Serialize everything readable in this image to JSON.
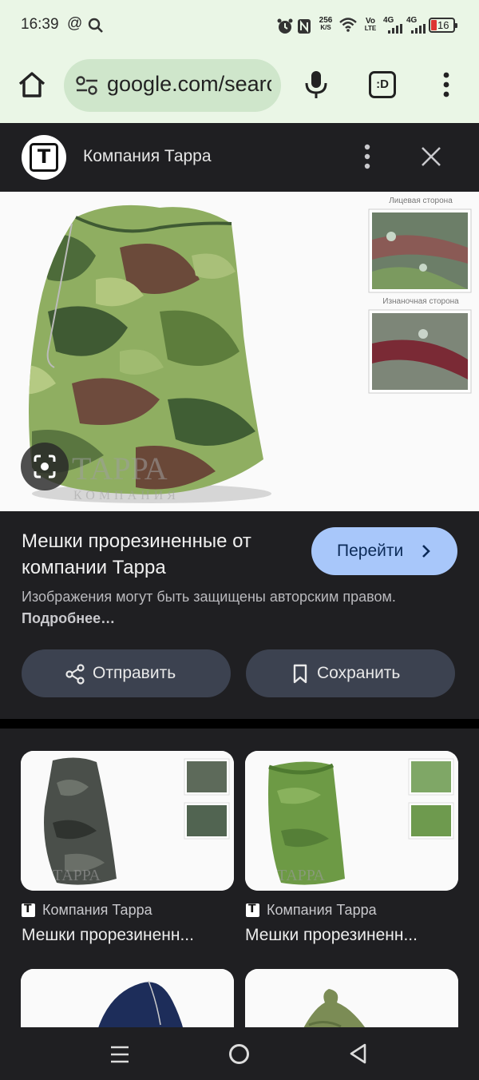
{
  "status_bar": {
    "time": "16:39",
    "at_icon": "@",
    "net_speed_value": "256",
    "net_speed_unit": "K/S",
    "volte_top": "Vo",
    "volte_bottom": "LTE",
    "signal1": "4G",
    "signal2": "4G",
    "battery": "16",
    "colors": {
      "battery_low": "#dd3333"
    }
  },
  "browser": {
    "url": "google.com/search",
    "tab_switcher_label": ":D"
  },
  "viewer": {
    "source_name": "Компания Тарра",
    "logo_letter": "T",
    "title": "Мешки прорезиненные от компании Тарра",
    "go_button": "Перейти",
    "copyright_text": "Изображения могут быть защищены авторским правом.",
    "copyright_link": "Подробнее…",
    "share_button": "Отправить",
    "save_button": "Сохранить",
    "image": {
      "watermark": "ТАРРА",
      "watermark_sub": "КОМПАНИЯ",
      "front_side_label": "Лицевая сторона",
      "back_side_label": "Изнаночная сторона"
    },
    "colors": {
      "go_button_bg": "#a8c7fa",
      "pill_bg": "#3c4250"
    }
  },
  "results": [
    {
      "source": "Компания Тарра",
      "title": "Мешки прорезиненн...",
      "variant": "dark-camo"
    },
    {
      "source": "Компания Тарра",
      "title": "Мешки прорезиненн...",
      "variant": "green-pixel"
    },
    {
      "source": "",
      "title": "",
      "variant": "navy"
    },
    {
      "source": "",
      "title": "",
      "variant": "olive"
    }
  ],
  "icons": {
    "home": "home-icon",
    "tune": "tune-icon",
    "mic": "mic-icon",
    "more": "more-vert-icon",
    "close": "close-icon",
    "lens": "lens-icon",
    "share": "share-icon",
    "bookmark": "bookmark-icon"
  }
}
